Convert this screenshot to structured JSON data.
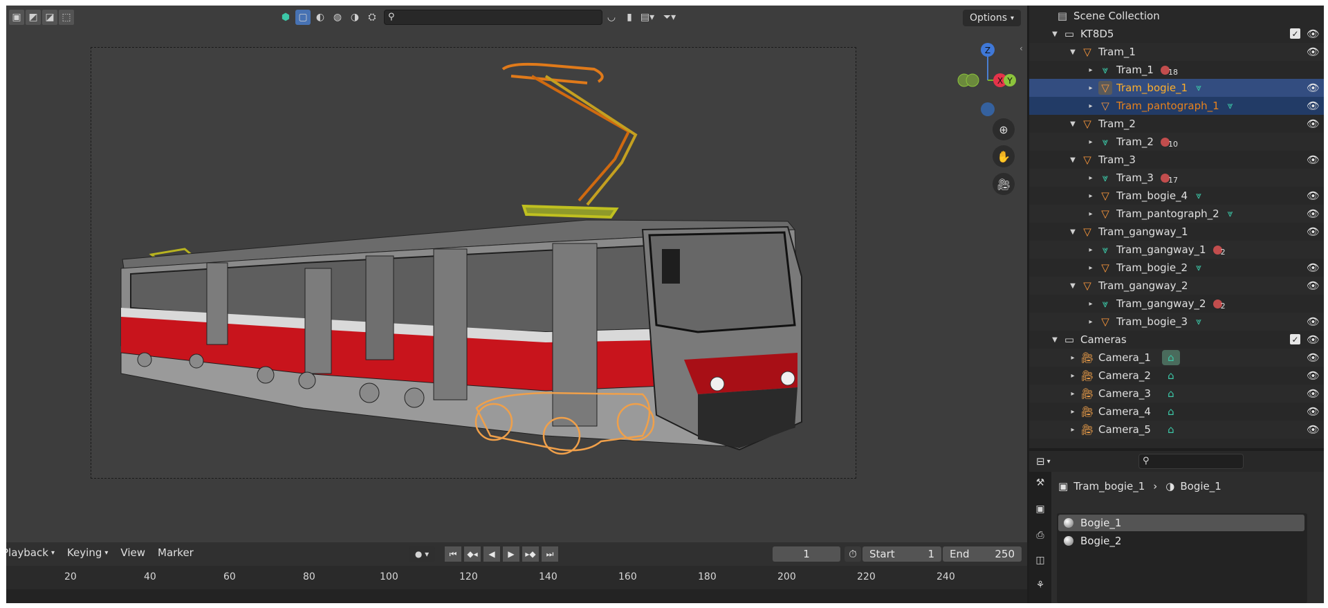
{
  "viewport": {
    "search": {
      "value": "",
      "placeholder": ""
    },
    "options_label": "Options",
    "gizmo": {
      "z": "Z",
      "x": "X",
      "y": "Y"
    }
  },
  "timeline": {
    "menu": {
      "playback": "Playback",
      "keying": "Keying",
      "view": "View",
      "marker": "Marker"
    },
    "current_frame": "1",
    "start_label": "Start",
    "start_value": "1",
    "end_label": "End",
    "end_value": "250",
    "ticks": [
      "20",
      "40",
      "60",
      "80",
      "100",
      "120",
      "140",
      "160",
      "180",
      "200",
      "220",
      "240"
    ]
  },
  "outliner": {
    "scene_collection": "Scene Collection",
    "rows": [
      {
        "name": "KT8D5"
      },
      {
        "name": "Tram_1"
      },
      {
        "name": "Tram_1",
        "badge": "18"
      },
      {
        "name": "Tram_bogie_1"
      },
      {
        "name": "Tram_pantograph_1"
      },
      {
        "name": "Tram_2"
      },
      {
        "name": "Tram_2",
        "badge": "10"
      },
      {
        "name": "Tram_3"
      },
      {
        "name": "Tram_3",
        "badge": "17"
      },
      {
        "name": "Tram_bogie_4"
      },
      {
        "name": "Tram_pantograph_2"
      },
      {
        "name": "Tram_gangway_1"
      },
      {
        "name": "Tram_gangway_1",
        "badge": "2"
      },
      {
        "name": "Tram_bogie_2"
      },
      {
        "name": "Tram_gangway_2"
      },
      {
        "name": "Tram_gangway_2",
        "badge": "2"
      },
      {
        "name": "Tram_bogie_3"
      },
      {
        "name": "Cameras"
      },
      {
        "name": "Camera_1"
      },
      {
        "name": "Camera_2"
      },
      {
        "name": "Camera_3"
      },
      {
        "name": "Camera_4"
      },
      {
        "name": "Camera_5"
      }
    ]
  },
  "properties": {
    "search": {
      "value": "",
      "placeholder": ""
    },
    "breadcrumb": {
      "object": "Tram_bogie_1",
      "material": "Bogie_1"
    },
    "materials": [
      "Bogie_1",
      "Bogie_2"
    ]
  },
  "colors": {
    "selection": "#334d80",
    "active_object": "#ffaf29",
    "mesh_data": "#3cc8a8",
    "tram_red": "#c8141c"
  },
  "icons": {
    "collection": "collection-icon",
    "object": "object-triangle-icon",
    "mesh": "mesh-data-icon",
    "camera": "camera-icon",
    "eye": "eye-icon"
  }
}
